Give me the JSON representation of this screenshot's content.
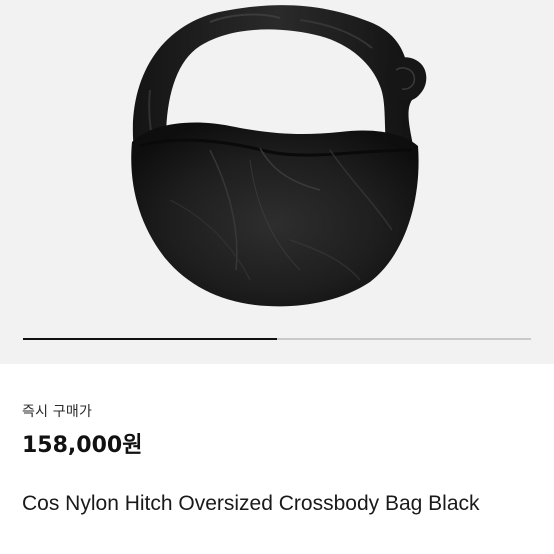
{
  "product": {
    "image_alt": "Cos Nylon Hitch Oversized Crossbody Bag Black",
    "gallery_progress_fraction": 0.5,
    "price_label": "즉시 구매가",
    "price": "158,000원",
    "title": "Cos Nylon Hitch Oversized Crossbody Bag Black",
    "cut_off_line": ""
  },
  "colors": {
    "gallery_bg": "#f2f2f2",
    "bag": "#1b1b1b",
    "progress_track": "#c9c9c9",
    "progress_fill": "#111111"
  }
}
